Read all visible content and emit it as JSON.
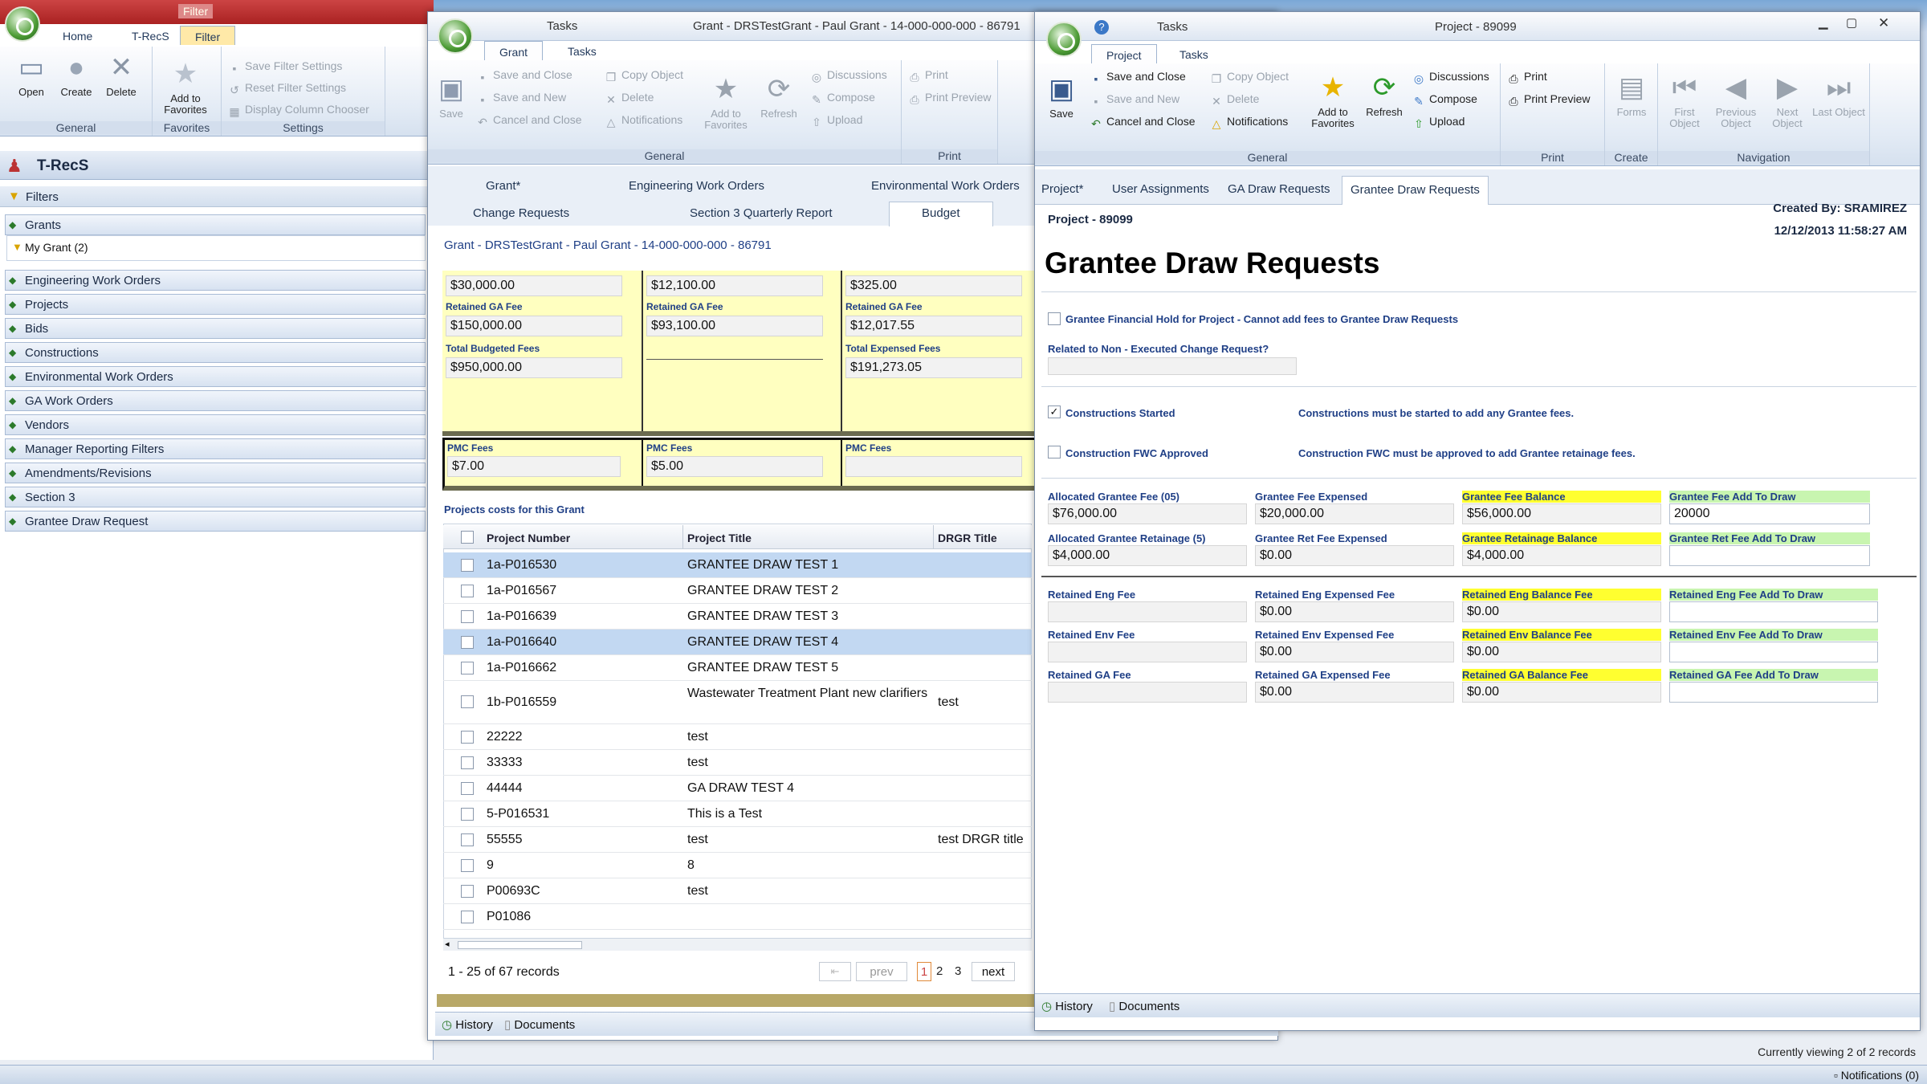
{
  "left_app": {
    "top_tabs": [
      "Home",
      "T-RecS",
      "Filter"
    ],
    "filter_caption": "Filter",
    "ribbon": {
      "general": {
        "label": "General",
        "open": "Open",
        "create": "Create",
        "delete": "Delete"
      },
      "favorites": {
        "label": "Favorites",
        "add": "Add to Favorites"
      },
      "settings": {
        "label": "Settings",
        "save": "Save Filter Settings",
        "reset": "Reset Filter Settings",
        "chooser": "Display Column Chooser"
      }
    },
    "app_title": "T-RecS",
    "filters_label": "Filters",
    "nav_items": [
      "Grants",
      "Engineering Work Orders",
      "Projects",
      "Bids",
      "Constructions",
      "Environmental Work Orders",
      "GA Work Orders",
      "Vendors",
      "Manager Reporting Filters",
      "Amendments/Revisions",
      "Section 3",
      "Grantee Draw Request"
    ],
    "my_grant": "My Grant (2)"
  },
  "grant_window": {
    "title_tab": "Tasks",
    "title": "Grant - DRSTestGrant - Paul Grant - 14-000-000-000 - 86791",
    "ribbon_tabs": [
      "Grant",
      "Tasks"
    ],
    "ribbon": {
      "save": "Save",
      "save_close": "Save and Close",
      "save_new": "Save and New",
      "cancel_close": "Cancel and Close",
      "copy": "Copy Object",
      "delete": "Delete",
      "notifications": "Notifications",
      "add_fav": "Add to Favorites",
      "refresh": "Refresh",
      "discussions": "Discussions",
      "compose": "Compose",
      "upload": "Upload",
      "print": "Print",
      "print_preview": "Print Preview",
      "general_label": "General",
      "print_label": "Print"
    },
    "tabs_row1": [
      "Grant*",
      "Engineering Work Orders",
      "Environmental Work Orders"
    ],
    "tabs_row2": [
      "Change Requests",
      "Section 3 Quarterly Report",
      "Budget"
    ],
    "header": "Grant - DRSTestGrant - Paul Grant - 14-000-000-000 - 86791",
    "budget": {
      "col1": {
        "top": "$30,000.00",
        "retained_label": "Retained GA Fee",
        "retained": "$150,000.00",
        "total_label": "Total Budgeted Fees",
        "total": "$950,000.00",
        "pmc_label": "PMC Fees",
        "pmc": "$7.00"
      },
      "col2": {
        "top": "$12,100.00",
        "retained_label": "Retained GA Fee",
        "retained": "$93,100.00",
        "pmc_label": "PMC Fees",
        "pmc": "$5.00"
      },
      "col3": {
        "top": "$325.00",
        "retained_label": "Retained GA Fee",
        "retained": "$12,017.55",
        "total_label": "Total Expensed Fees",
        "total": "$191,273.05",
        "pmc_label": "PMC Fees",
        "pmc": ""
      }
    },
    "projects_caption": "Projects costs for this Grant",
    "columns": [
      "Project Number",
      "Project Title",
      "DRGR Title"
    ],
    "rows": [
      {
        "num": "1a-P016530",
        "title": "GRANTEE DRAW TEST 1",
        "drgr": "",
        "sel": true
      },
      {
        "num": "1a-P016567",
        "title": "GRANTEE DRAW TEST 2",
        "drgr": "",
        "sel": false
      },
      {
        "num": "1a-P016639",
        "title": "GRANTEE DRAW TEST 3",
        "drgr": "",
        "sel": false
      },
      {
        "num": "1a-P016640",
        "title": "GRANTEE DRAW TEST 4",
        "drgr": "",
        "sel": true
      },
      {
        "num": "1a-P016662",
        "title": "GRANTEE DRAW TEST 5",
        "drgr": "",
        "sel": false
      },
      {
        "num": "1b-P016559",
        "title": "Wastewater Treatment Plant new clarifiers",
        "drgr": "test",
        "sel": false
      },
      {
        "num": "22222",
        "title": "test",
        "drgr": "",
        "sel": false
      },
      {
        "num": "33333",
        "title": "test",
        "drgr": "",
        "sel": false
      },
      {
        "num": "44444",
        "title": "GA DRAW TEST 4",
        "drgr": "",
        "sel": false
      },
      {
        "num": "5-P016531",
        "title": "This is a Test",
        "drgr": "",
        "sel": false
      },
      {
        "num": "55555",
        "title": "test",
        "drgr": "test DRGR title",
        "sel": false
      },
      {
        "num": "9",
        "title": "8",
        "drgr": "",
        "sel": false
      },
      {
        "num": "P00693C",
        "title": "test",
        "drgr": "",
        "sel": false
      },
      {
        "num": "P01086",
        "title": "",
        "drgr": "",
        "sel": false
      }
    ],
    "records": "1 - 25 of 67 records",
    "pager": {
      "prev": "prev",
      "pages": [
        "1",
        "2",
        "3"
      ],
      "next": "next"
    },
    "bottom_tabs": [
      "History",
      "Documents"
    ]
  },
  "project_window": {
    "title_tab": "Tasks",
    "title": "Project - 89099",
    "ribbon_tabs": [
      "Project",
      "Tasks"
    ],
    "ribbon": {
      "save": "Save",
      "save_close": "Save and Close",
      "save_new": "Save and New",
      "cancel_close": "Cancel and Close",
      "copy": "Copy Object",
      "delete": "Delete",
      "notifications": "Notifications",
      "add_fav": "Add to Favorites",
      "refresh": "Refresh",
      "discussions": "Discussions",
      "compose": "Compose",
      "upload": "Upload",
      "print": "Print",
      "print_preview": "Print Preview",
      "forms": "Forms",
      "first": "First Object",
      "previous": "Previous Object",
      "next": "Next Object",
      "last": "Last Object",
      "general_label": "General",
      "print_label": "Print",
      "create_label": "Create",
      "nav_label": "Navigation"
    },
    "tabs": [
      "Project*",
      "User Assignments",
      "GA Draw Requests",
      "Grantee Draw Requests"
    ],
    "project_id": "Project - 89099",
    "created_by": "Created By: SRAMIREZ",
    "created_at": "12/12/2013 11:58:27 AM",
    "heading": "Grantee Draw Requests",
    "hold_label": "Grantee Financial Hold for Project - Cannot add fees to Grantee Draw Requests",
    "related_label": "Related to Non - Executed Change Request?",
    "constructions_started": "Constructions Started",
    "constructions_note": "Constructions must be started to add any Grantee fees.",
    "fwc_label": "Construction FWC Approved",
    "fwc_note": "Construction FWC must be approved to add Grantee retainage fees.",
    "fees": {
      "alloc_fee_label": "Allocated Grantee Fee (05)",
      "alloc_fee": "$76,000.00",
      "fee_exp_label": "Grantee Fee Expensed",
      "fee_exp": "$20,000.00",
      "fee_bal_label": "Grantee Fee Balance",
      "fee_bal": "$56,000.00",
      "fee_add_label": "Grantee Fee Add To Draw",
      "fee_add": "20000",
      "alloc_ret_label": "Allocated Grantee Retainage (5)",
      "alloc_ret": "$4,000.00",
      "ret_exp_label": "Grantee Ret Fee Expensed",
      "ret_exp": "$0.00",
      "ret_bal_label": "Grantee Retainage Balance",
      "ret_bal": "$4,000.00",
      "ret_add_label": "Grantee Ret Fee Add To Draw",
      "ret_add": "",
      "eng_label": "Retained Eng Fee",
      "eng": "",
      "eng_exp_label": "Retained Eng Expensed Fee",
      "eng_exp": "$0.00",
      "eng_bal_label": "Retained Eng Balance Fee",
      "eng_bal": "$0.00",
      "eng_add_label": "Retained Eng Fee Add To Draw",
      "eng_add": "",
      "env_label": "Retained Env Fee",
      "env": "",
      "env_exp_label": "Retained Env Expensed Fee",
      "env_exp": "$0.00",
      "env_bal_label": "Retained Env Balance Fee",
      "env_bal": "$0.00",
      "env_add_label": "Retained Env Fee Add To Draw",
      "env_add": "",
      "ga_label": "Retained GA Fee",
      "ga": "",
      "ga_exp_label": "Retained GA Expensed Fee",
      "ga_exp": "$0.00",
      "ga_bal_label": "Retained GA Balance Fee",
      "ga_bal": "$0.00",
      "ga_add_label": "Retained GA Fee Add To Draw",
      "ga_add": ""
    },
    "bottom_tabs": [
      "History",
      "Documents"
    ]
  },
  "status": {
    "viewing": "Currently viewing 2 of 2 records",
    "notifications": "Notifications (0)"
  },
  "colors": {
    "highlight_yellow": "#ffff30",
    "highlight_green": "#c8f5b0",
    "label_blue": "#1f3f86",
    "budget_yellow": "#ffffc0"
  }
}
